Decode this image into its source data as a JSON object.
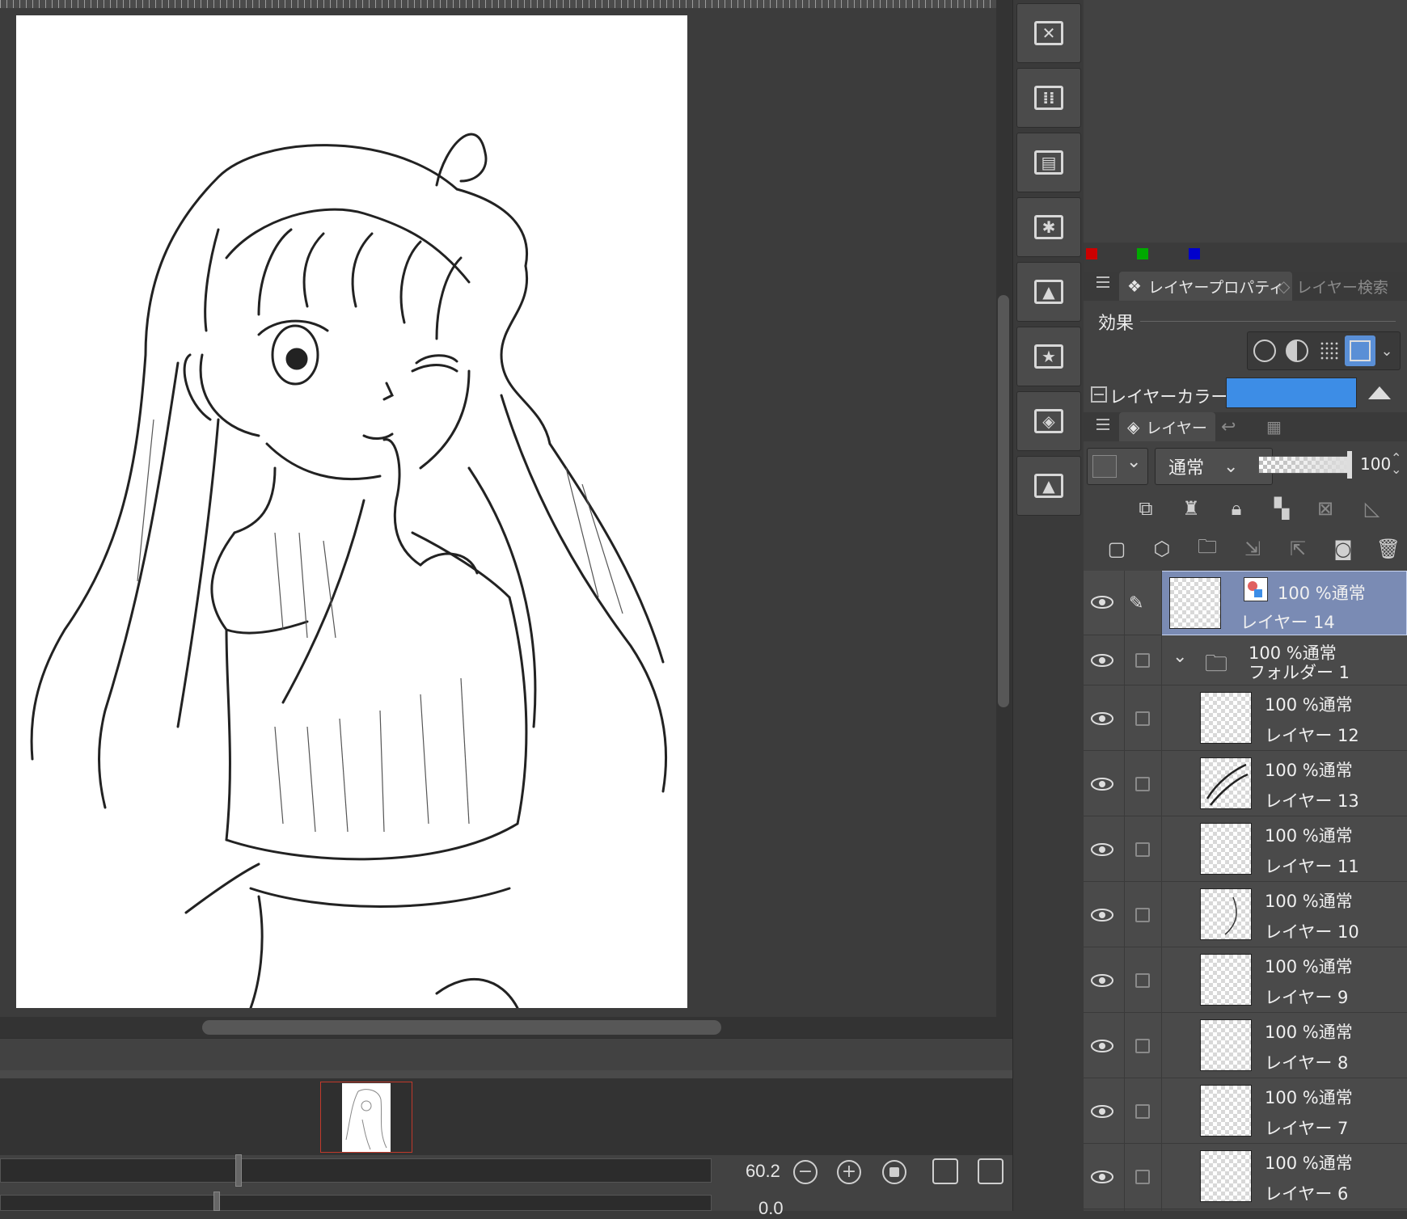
{
  "canvas": {
    "zoom_value": "60.2",
    "rotation_value": "0.0"
  },
  "color_swatches": [
    "#cc0000",
    "#00aa00",
    "#0000cc"
  ],
  "property_panel": {
    "tabs": [
      {
        "label": "レイヤープロパティ",
        "active": true
      },
      {
        "label": "レイヤー検索",
        "active": false
      }
    ],
    "effect_label": "効果",
    "layer_color_label": "レイヤーカラー",
    "layer_color": "#3d8de6"
  },
  "layer_panel": {
    "tabs": [
      {
        "label": "レイヤー",
        "active": true
      }
    ],
    "blend_mode": "通常",
    "opacity": "100",
    "layers": [
      {
        "mode": "100 %通常",
        "name": "レイヤー 14",
        "selected": true,
        "kind": "layer"
      },
      {
        "mode": "100 %通常",
        "name": "フォルダー 1",
        "selected": false,
        "kind": "folder"
      },
      {
        "mode": "100 %通常",
        "name": "レイヤー 12",
        "selected": false,
        "kind": "layer"
      },
      {
        "mode": "100 %通常",
        "name": "レイヤー 13",
        "selected": false,
        "kind": "layer"
      },
      {
        "mode": "100 %通常",
        "name": "レイヤー 11",
        "selected": false,
        "kind": "layer"
      },
      {
        "mode": "100 %通常",
        "name": "レイヤー 10",
        "selected": false,
        "kind": "layer"
      },
      {
        "mode": "100 %通常",
        "name": "レイヤー 9",
        "selected": false,
        "kind": "layer"
      },
      {
        "mode": "100 %通常",
        "name": "レイヤー 8",
        "selected": false,
        "kind": "layer"
      },
      {
        "mode": "100 %通常",
        "name": "レイヤー 7",
        "selected": false,
        "kind": "layer"
      },
      {
        "mode": "100 %通常",
        "name": "レイヤー 6",
        "selected": false,
        "kind": "layer"
      }
    ]
  }
}
